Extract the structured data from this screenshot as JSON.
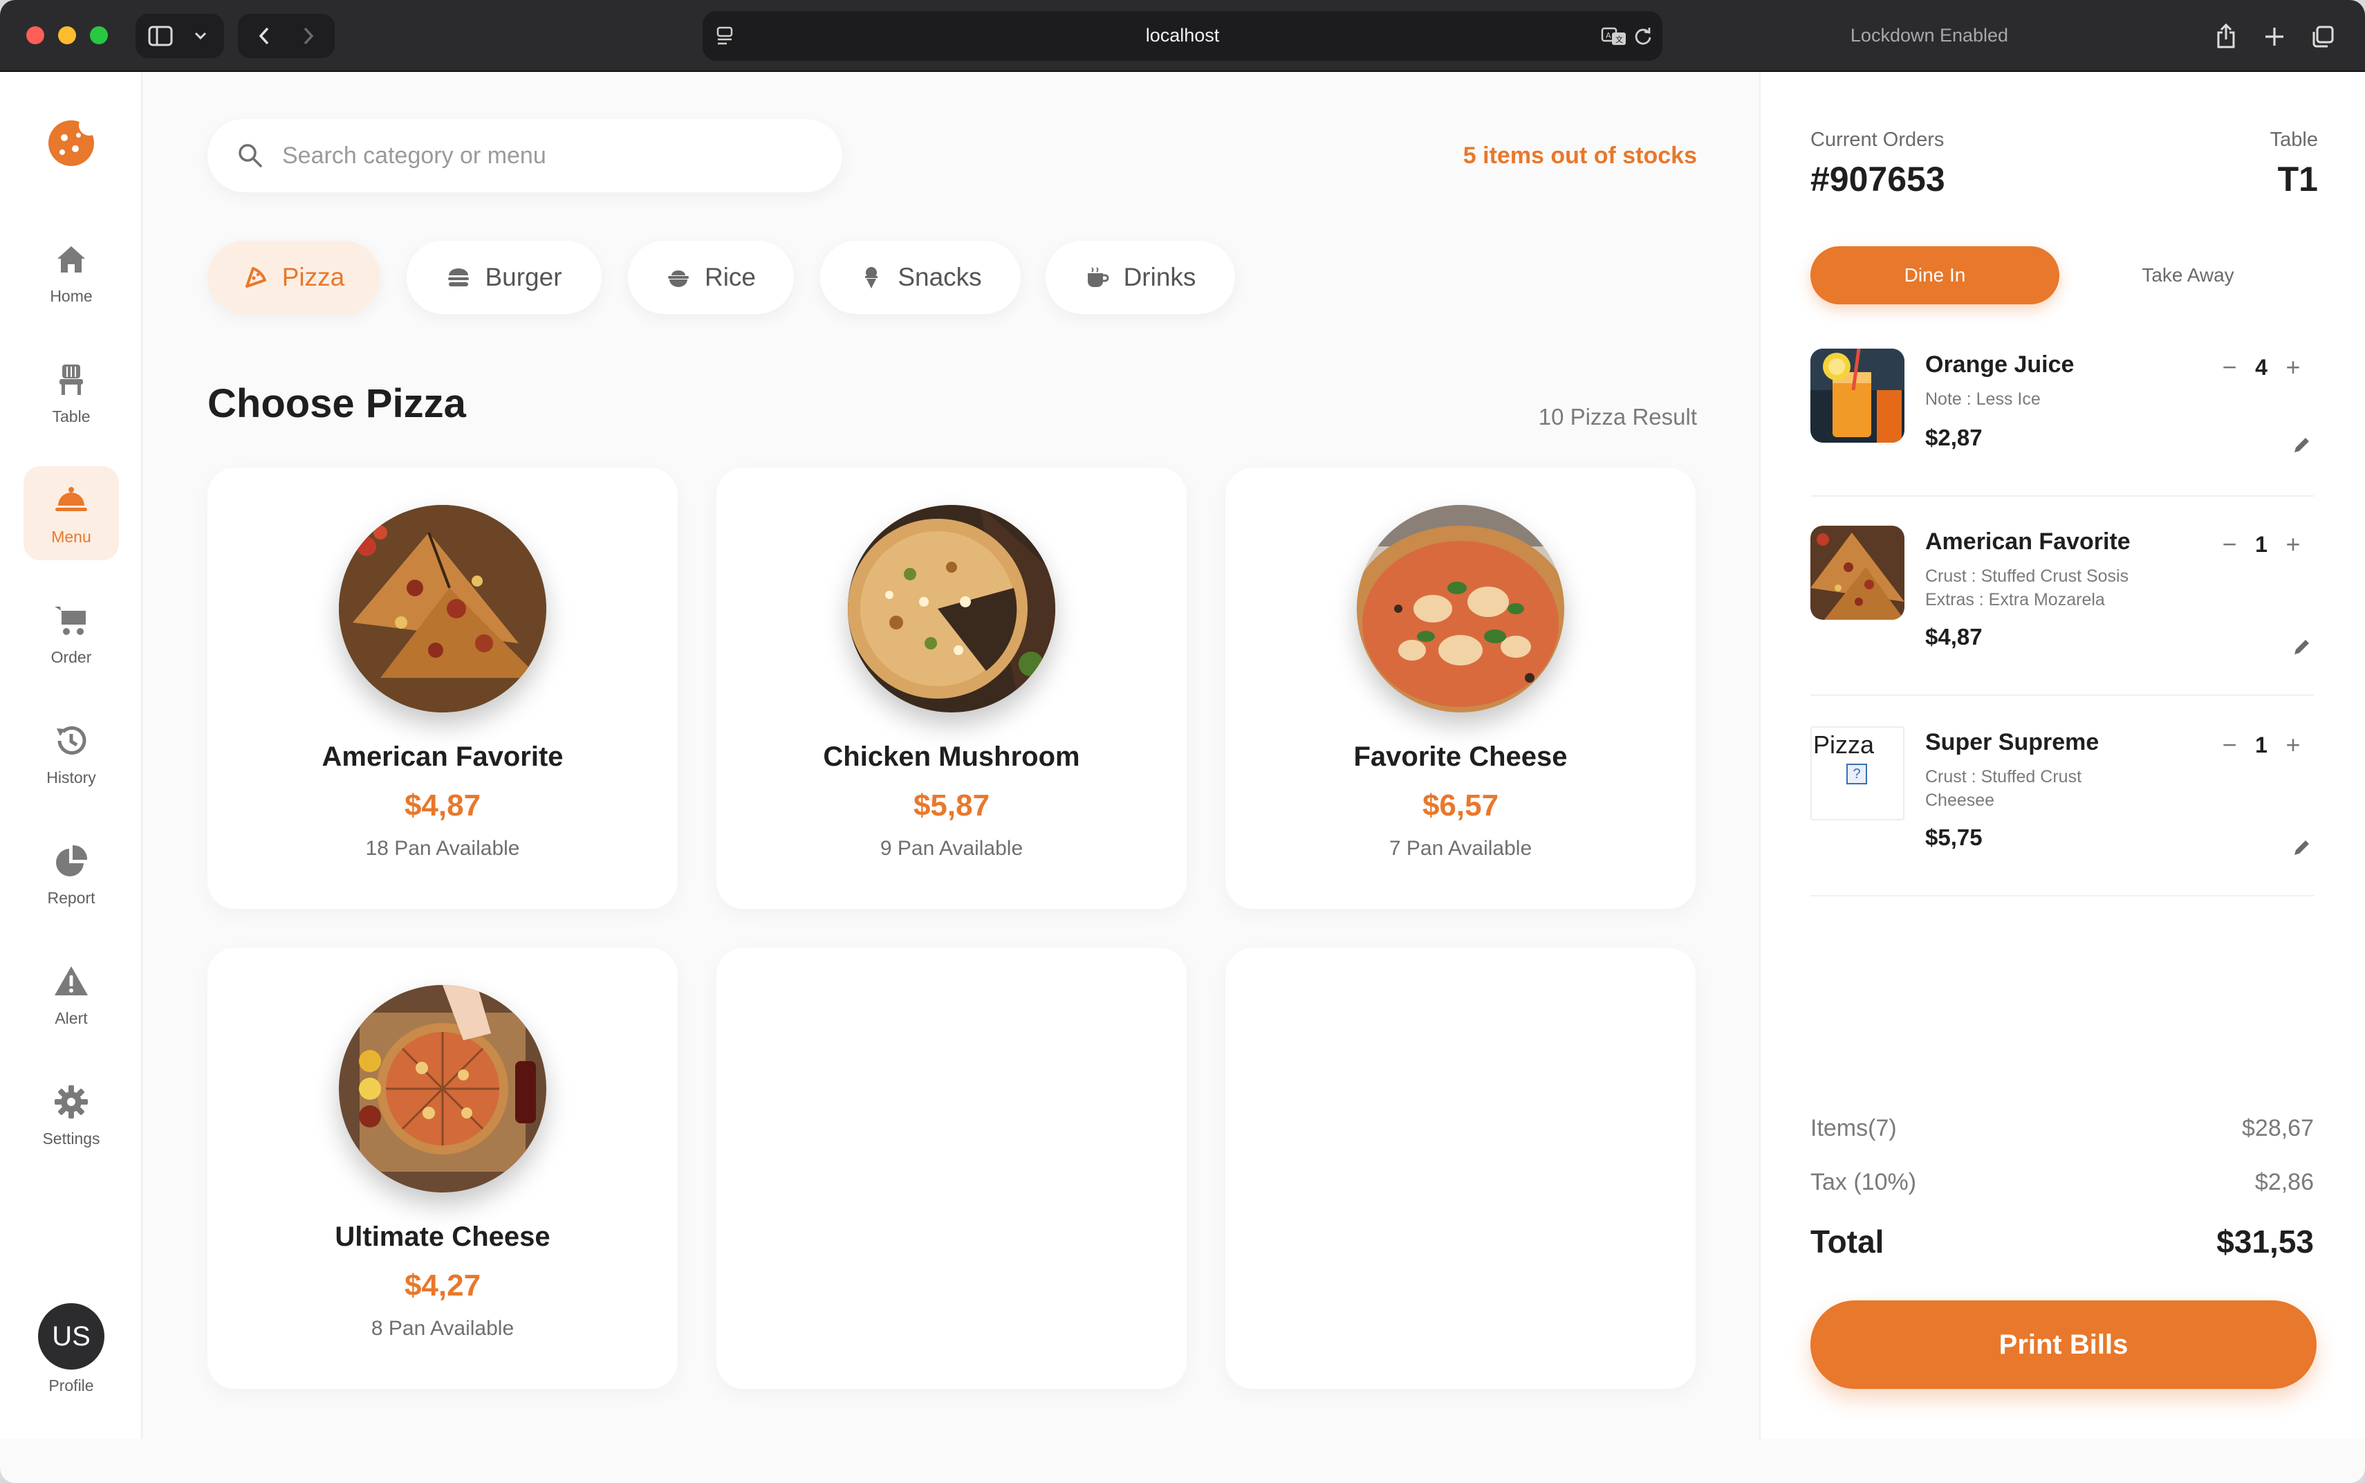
{
  "browser": {
    "address": "localhost",
    "status": "Lockdown Enabled"
  },
  "sidebar": {
    "items": [
      {
        "label": "Home",
        "icon": "home-icon"
      },
      {
        "label": "Table",
        "icon": "chair-icon"
      },
      {
        "label": "Menu",
        "icon": "cloche-icon",
        "active": true
      },
      {
        "label": "Order",
        "icon": "cart-icon"
      },
      {
        "label": "History",
        "icon": "history-icon"
      },
      {
        "label": "Report",
        "icon": "pie-chart-icon"
      },
      {
        "label": "Alert",
        "icon": "warning-icon"
      },
      {
        "label": "Settings",
        "icon": "gear-icon"
      }
    ],
    "avatar": "US",
    "profile_label": "Profile"
  },
  "search": {
    "placeholder": "Search category or menu",
    "value": ""
  },
  "stock_notice": "5 items out of stocks",
  "categories": [
    {
      "label": "Pizza",
      "icon": "pizza-icon",
      "active": true
    },
    {
      "label": "Burger",
      "icon": "burger-icon"
    },
    {
      "label": "Rice",
      "icon": "rice-bowl-icon"
    },
    {
      "label": "Snacks",
      "icon": "ice-cream-icon"
    },
    {
      "label": "Drinks",
      "icon": "coffee-cup-icon"
    }
  ],
  "section": {
    "title": "Choose Pizza",
    "result_count": "10 Pizza Result"
  },
  "menu_items": [
    {
      "name": "American Favorite",
      "price": "$4,87",
      "stock": "18 Pan Available"
    },
    {
      "name": "Chicken Mushroom",
      "price": "$5,87",
      "stock": "9 Pan Available"
    },
    {
      "name": "Favorite Cheese",
      "price": "$6,57",
      "stock": "7 Pan Available"
    },
    {
      "name": "Ultimate Cheese",
      "price": "$4,27",
      "stock": "8 Pan Available"
    }
  ],
  "order": {
    "current_label": "Current Orders",
    "number": "#907653",
    "table_label": "Table",
    "table": "T1",
    "modes": [
      {
        "label": "Dine In",
        "active": true
      },
      {
        "label": "Take Away",
        "active": false
      }
    ],
    "items": [
      {
        "name": "Orange Juice",
        "notes": [
          "Note : Less Ice"
        ],
        "price": "$2,87",
        "qty": "4"
      },
      {
        "name": "American Favorite",
        "notes": [
          "Crust : Stuffed Crust Sosis",
          "Extras : Extra Mozarela"
        ],
        "price": "$4,87",
        "qty": "1"
      },
      {
        "name": "Super Supreme",
        "notes": [
          "Crust : Stuffed Crust",
          "Cheesee"
        ],
        "price": "$5,75",
        "qty": "1",
        "image_alt": "Pizza"
      }
    ],
    "summary": {
      "items_label": "Items(7)",
      "items_value": "$28,67",
      "tax_label": "Tax (10%)",
      "tax_value": "$2,86",
      "total_label": "Total",
      "total_value": "$31,53"
    },
    "print_label": "Print Bills"
  },
  "colors": {
    "accent": "#e8782b",
    "accent_soft": "#fdeee3",
    "text": "#1f1f1f"
  }
}
